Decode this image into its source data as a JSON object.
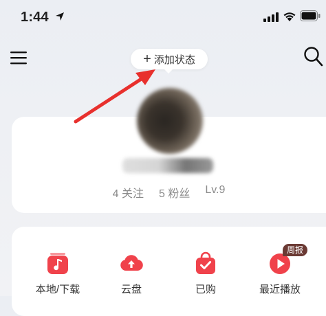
{
  "status_bar": {
    "time": "1:44"
  },
  "header": {
    "add_status_label": "添加状态",
    "add_status_plus": "+"
  },
  "profile": {
    "stats": {
      "following": "4 关注",
      "followers": "5 粉丝",
      "level": "Lv.9"
    }
  },
  "shortcuts": [
    {
      "label": "本地/下载",
      "icon": "music-note-icon"
    },
    {
      "label": "云盘",
      "icon": "cloud-upload-icon"
    },
    {
      "label": "已购",
      "icon": "shopping-bag-check-icon"
    },
    {
      "label": "最近播放",
      "icon": "play-icon",
      "badge": "周报"
    }
  ],
  "colors": {
    "accent": "#f0424b",
    "card": "#ffffff",
    "annotation": "#e8302d"
  }
}
